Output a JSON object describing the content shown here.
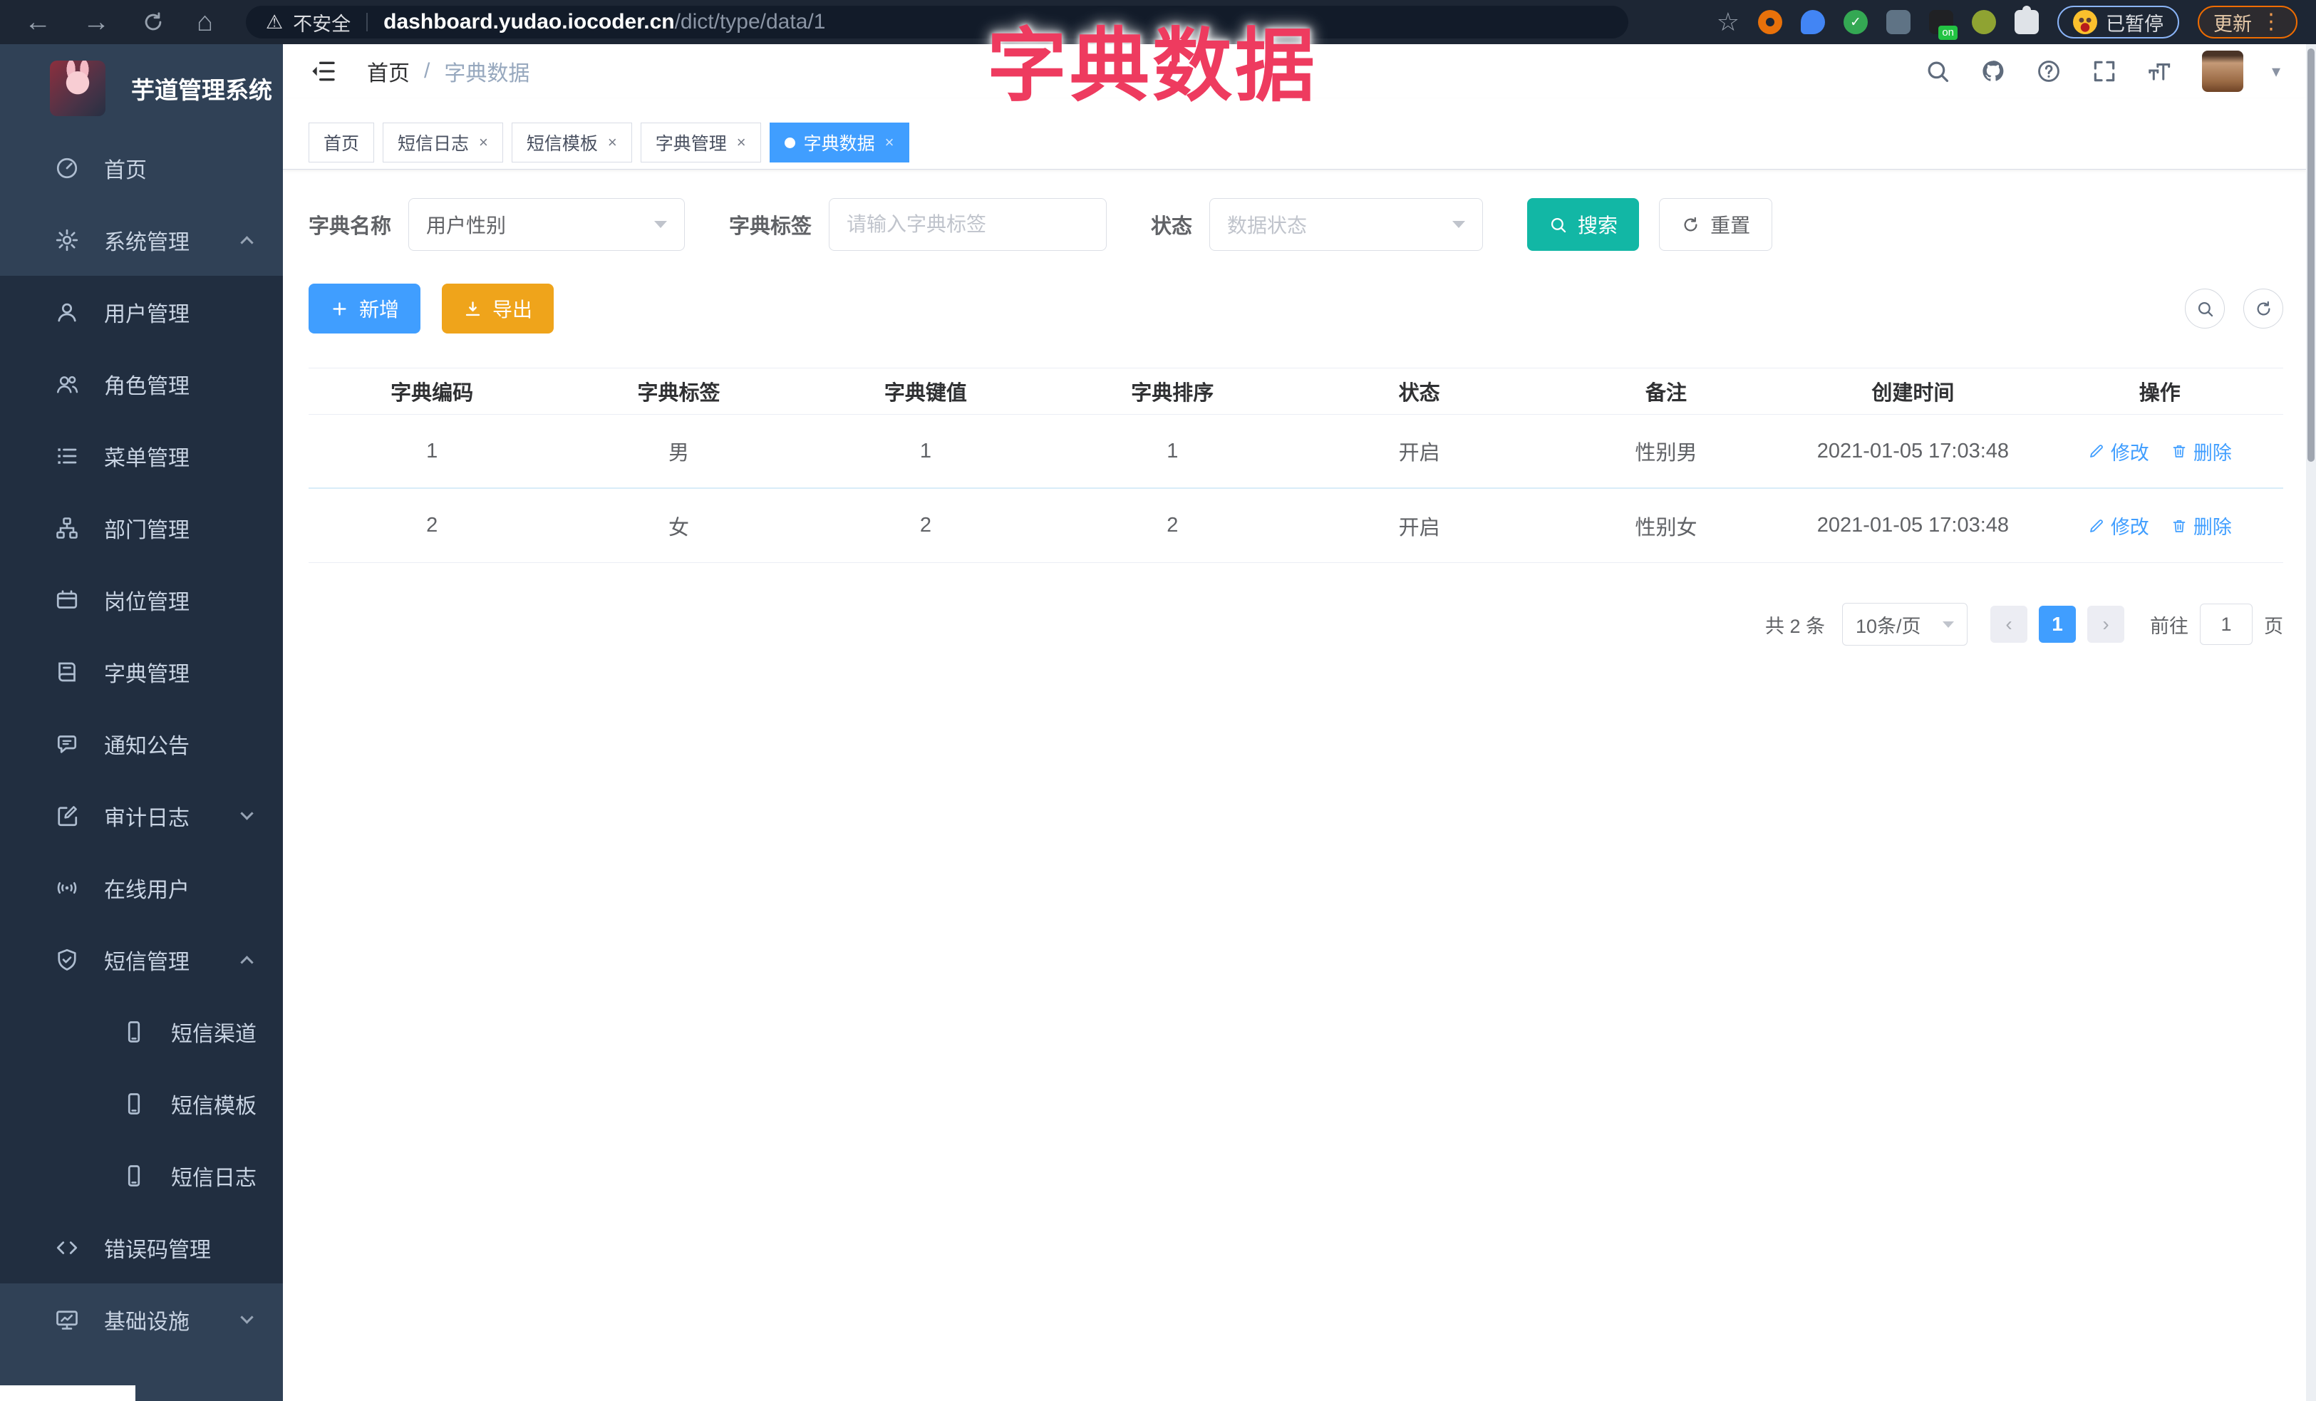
{
  "annotation": {
    "title": "字典数据",
    "color": "#EE3B5F"
  },
  "browser": {
    "not_secure_label": "不安全",
    "url_host": "dashboard.yudao.iocoder.cn",
    "url_path": "/dict/type/data/1",
    "paused_badge": "已暂停",
    "update_label": "更新"
  },
  "sidebar": {
    "logo_title": "芋道管理系统",
    "items": [
      {
        "label": "首页",
        "icon": "gauge",
        "level": 0,
        "section": "base"
      },
      {
        "label": "系统管理",
        "icon": "gear",
        "level": 0,
        "section": "base",
        "chevUp": true
      },
      {
        "label": "用户管理",
        "icon": "user",
        "level": 1,
        "section": "sub"
      },
      {
        "label": "角色管理",
        "icon": "users",
        "level": 1,
        "section": "sub"
      },
      {
        "label": "菜单管理",
        "icon": "list",
        "level": 1,
        "section": "sub"
      },
      {
        "label": "部门管理",
        "icon": "tree",
        "level": 1,
        "section": "sub"
      },
      {
        "label": "岗位管理",
        "icon": "card",
        "level": 1,
        "section": "sub"
      },
      {
        "label": "字典管理",
        "icon": "book",
        "level": 1,
        "section": "sub"
      },
      {
        "label": "通知公告",
        "icon": "chat",
        "level": 1,
        "section": "sub"
      },
      {
        "label": "审计日志",
        "icon": "edit",
        "level": 1,
        "section": "sub",
        "chevDown": true
      },
      {
        "label": "在线用户",
        "icon": "online",
        "level": 1,
        "section": "sub"
      },
      {
        "label": "短信管理",
        "icon": "shield",
        "level": 1,
        "section": "sub",
        "chevUp": true
      },
      {
        "label": "短信渠道",
        "icon": "phone",
        "level": 2,
        "section": "sub"
      },
      {
        "label": "短信模板",
        "icon": "phone",
        "level": 2,
        "section": "sub"
      },
      {
        "label": "短信日志",
        "icon": "phone",
        "level": 2,
        "section": "sub"
      },
      {
        "label": "错误码管理",
        "icon": "code",
        "level": 1,
        "section": "sub"
      },
      {
        "label": "基础设施",
        "icon": "monitor",
        "level": 0,
        "section": "base",
        "chevDown": true
      }
    ]
  },
  "header": {
    "breadcrumb": [
      "首页",
      "字典数据"
    ],
    "separator": "/"
  },
  "tabs": [
    {
      "label": "首页"
    },
    {
      "label": "短信日志",
      "closable": true
    },
    {
      "label": "短信模板",
      "closable": true
    },
    {
      "label": "字典管理",
      "closable": true
    },
    {
      "label": "字典数据",
      "closable": true,
      "active": true
    }
  ],
  "filters": {
    "name_label": "字典名称",
    "name_value": "用户性别",
    "tag_label": "字典标签",
    "tag_placeholder": "请输入字典标签",
    "status_label": "状态",
    "status_placeholder": "数据状态",
    "search_label": "搜索",
    "reset_label": "重置"
  },
  "toolbar": {
    "add_label": "新增",
    "export_label": "导出"
  },
  "table": {
    "headers": [
      "字典编码",
      "字典标签",
      "字典键值",
      "字典排序",
      "状态",
      "备注",
      "创建时间",
      "操作"
    ],
    "rows": [
      {
        "code": "1",
        "label": "男",
        "value": "1",
        "sort": "1",
        "status": "开启",
        "remark": "性别男",
        "created": "2021-01-05 17:03:48"
      },
      {
        "code": "2",
        "label": "女",
        "value": "2",
        "sort": "2",
        "status": "开启",
        "remark": "性别女",
        "created": "2021-01-05 17:03:48"
      }
    ],
    "actions": {
      "edit": "修改",
      "delete": "删除"
    }
  },
  "pagination": {
    "total": "共 2 条",
    "page_size": "10条/页",
    "current_page": "1",
    "goto_prefix": "前往",
    "goto_value": "1",
    "goto_suffix": "页"
  },
  "colors": {
    "primary": "#409EFF",
    "warning": "#EFA41B",
    "search_teal": "#12B7A5",
    "sidebar_bg": "#304156",
    "submenu_bg": "#212E40",
    "annotation": "#EE3B5F",
    "chrome_bg": "#1D2634"
  }
}
